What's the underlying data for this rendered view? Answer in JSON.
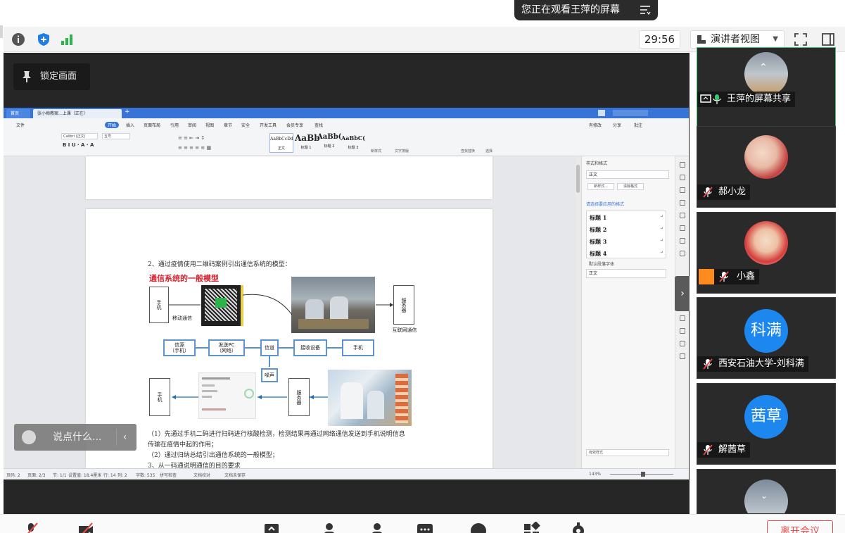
{
  "banner": {
    "text": "您正在观看王萍的屏幕"
  },
  "toolbar": {
    "timer": "29:56",
    "view_mode": "演讲者视图"
  },
  "main": {
    "lock_label": "锁定画面",
    "chat_placeholder": "说点什么..."
  },
  "shared_doc": {
    "tab_home": "首页",
    "tab_doc": "张小梅教案...上课（正在）",
    "menu": [
      "文件",
      "开始",
      "插入",
      "页面布局",
      "引用",
      "审阅",
      "视图",
      "章节",
      "安全",
      "开发工具",
      "会员专享",
      "查找"
    ],
    "menu_right": [
      "有修改",
      "分享",
      "批注"
    ],
    "font_name": "Calibri (正文)",
    "font_size": "五号",
    "styles": [
      "AaBbCcDd",
      "AaBb",
      "AaBb(",
      "AaBbC("
    ],
    "style_names": [
      "正文",
      "标题 1",
      "标题 2",
      "标题 3"
    ],
    "ribbon_right": [
      "新样式",
      "文字排版",
      "查找替换",
      "选择"
    ],
    "line1": "2、通过疫情使用二维码案例引出通信系统的模型：",
    "heading": "通信系统的一般模型",
    "flow_top": {
      "phone": "手机",
      "mobile_comm": "移动通信",
      "server": "服务器",
      "internet": "互联网通信"
    },
    "flow_mid": [
      "信源\n（手机）",
      "发送PC\n（网络）",
      "信道",
      "接收设备",
      "手机"
    ],
    "noise": "噪声",
    "flow_bot": {
      "phone": "手机",
      "server": "服务器"
    },
    "para1": "（1）先通过手机二码进行扫码进行核酸检测，检测结果再通过网络通信发送到手机说明信息",
    "para1b": "传输在疫情中起的作用；",
    "para2": "（2）通过归纳总结引出通信系统的一般模型；",
    "para3": "3、从一码通说明通信的目的要求",
    "pane_title": "样式和格式",
    "pane_current": "正文",
    "pane_btn1": "新样式...",
    "pane_btn2": "清除格式",
    "pane_section": "请选择要应用的格式",
    "pane_items": [
      "标题 1",
      "标题 2",
      "标题 3",
      "标题 4"
    ],
    "pane_default": "默认段落字体",
    "pane_body": "正文",
    "pane_show": "有效样式",
    "status": [
      "页码: 2",
      "页面: 2/3",
      "节: 1/1",
      "设置值: 18.4厘米",
      "行: 14",
      "列: 2",
      "字数: 535",
      "拼写检查",
      "文档校对",
      "文档未保存"
    ],
    "zoom": "143%"
  },
  "participants": [
    {
      "name": "王萍的屏幕共享",
      "type": "share"
    },
    {
      "name": "郝小龙",
      "type": "photo"
    },
    {
      "name": "小鑫",
      "type": "photo"
    },
    {
      "name": "西安石油大学-刘科满",
      "avatar_text": "科满"
    },
    {
      "name": "解茜草",
      "avatar_text": "茜草"
    }
  ],
  "bottom": {
    "leave_label": "离开会议"
  },
  "colors": {
    "accent_green": "#3ac26d",
    "avatar_blue": "#1d87f0",
    "danger_red": "#e64a4a",
    "wps_blue": "#3874d8",
    "doc_heading_red": "#d7232f"
  }
}
